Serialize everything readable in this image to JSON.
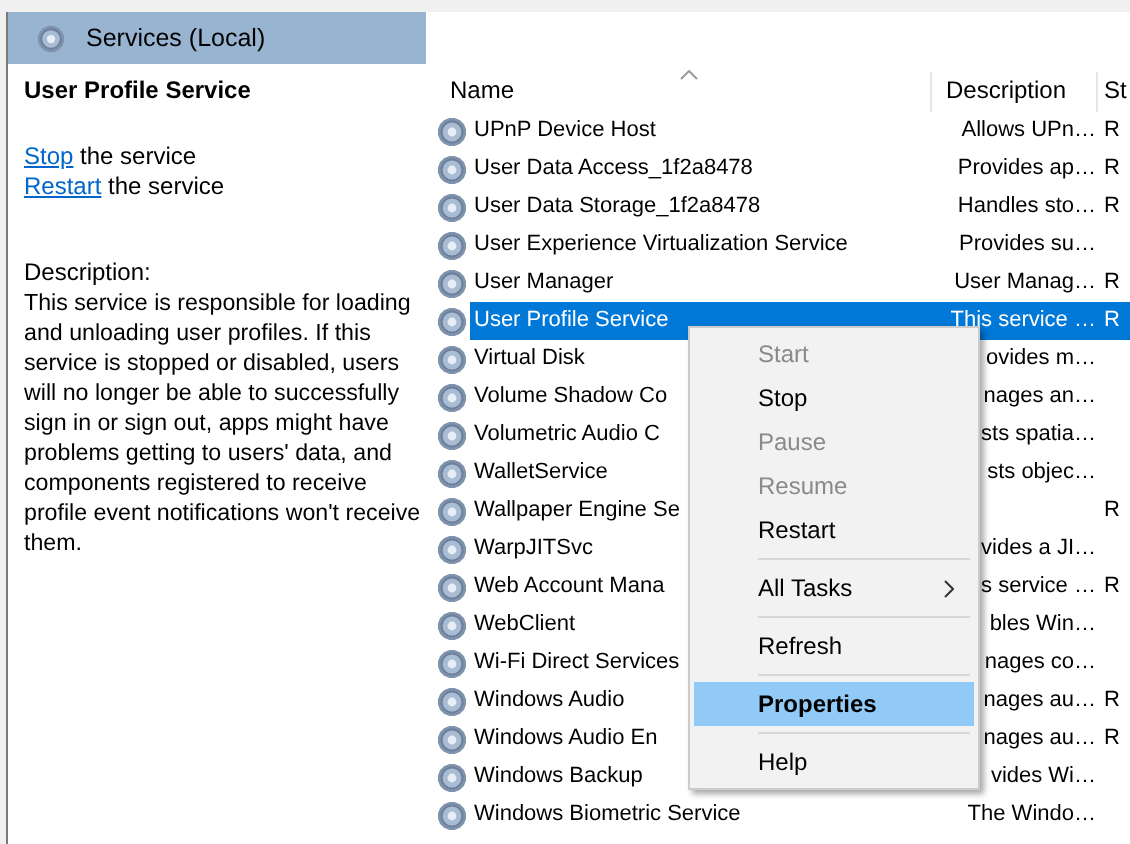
{
  "header": {
    "title": "Services (Local)"
  },
  "details": {
    "title": "User Profile Service",
    "actions": [
      {
        "link": "Stop",
        "text": " the service"
      },
      {
        "link": "Restart",
        "text": " the service"
      }
    ],
    "description_label": "Description:",
    "description": "This service is responsible for loading and unloading user profiles. If this service is stopped or disabled, users will no longer be able to successfully sign in or sign out, apps might have problems getting to users' data, and components registered to receive profile event notifications won't receive them."
  },
  "table": {
    "columns": [
      {
        "label": "Name",
        "sorted": true
      },
      {
        "label": "Description",
        "sorted": false
      },
      {
        "label": "St",
        "sorted": false
      }
    ],
    "rows": [
      {
        "name": "UPnP Device Host",
        "description": "Allows UPn…",
        "status": "R",
        "selected": false
      },
      {
        "name": "User Data Access_1f2a8478",
        "description": "Provides ap…",
        "status": "R",
        "selected": false
      },
      {
        "name": "User Data Storage_1f2a8478",
        "description": "Handles sto…",
        "status": "R",
        "selected": false
      },
      {
        "name": "User Experience Virtualization Service",
        "description": "Provides su…",
        "selected": false
      },
      {
        "name": "User Manager",
        "description": "User Manag…",
        "status": "R",
        "selected": false
      },
      {
        "name": "User Profile Service",
        "description": "This service …",
        "status": "R",
        "selected": true
      },
      {
        "name": "Virtual Disk",
        "description": "ovides m…",
        "selected": false
      },
      {
        "name": "Volume Shadow Co",
        "description": "nages an…",
        "selected": false
      },
      {
        "name": "Volumetric Audio C",
        "description": "sts spatia…",
        "selected": false
      },
      {
        "name": "WalletService",
        "description": "sts objec…",
        "selected": false
      },
      {
        "name": "Wallpaper Engine Se",
        "status": "R",
        "selected": false
      },
      {
        "name": "WarpJITSvc",
        "description": "vides a JI…",
        "selected": false
      },
      {
        "name": "Web Account Mana",
        "description": "s service …",
        "status": "R",
        "selected": false
      },
      {
        "name": "WebClient",
        "description": "bles Win…",
        "selected": false
      },
      {
        "name": "Wi-Fi Direct Services",
        "description": "nages co…",
        "selected": false
      },
      {
        "name": "Windows Audio",
        "description": "nages au…",
        "status": "R",
        "selected": false
      },
      {
        "name": "Windows Audio En",
        "description": "nages au…",
        "status": "R",
        "selected": false
      },
      {
        "name": "Windows Backup",
        "description": "vides Wi…",
        "selected": false
      },
      {
        "name": "Windows Biometric Service",
        "description": "The Windo…",
        "selected": false
      }
    ]
  },
  "context_menu": {
    "items": [
      {
        "kind": "item",
        "label": "Start",
        "disabled": true,
        "selected": false
      },
      {
        "kind": "item",
        "label": "Stop",
        "disabled": false,
        "selected": false
      },
      {
        "kind": "item",
        "label": "Pause",
        "disabled": true,
        "selected": false
      },
      {
        "kind": "item",
        "label": "Resume",
        "disabled": true,
        "selected": false
      },
      {
        "kind": "item",
        "label": "Restart",
        "disabled": false,
        "selected": false
      },
      {
        "kind": "separator"
      },
      {
        "kind": "submenu",
        "label": "All Tasks",
        "disabled": false,
        "selected": false
      },
      {
        "kind": "separator"
      },
      {
        "kind": "item",
        "label": "Refresh",
        "disabled": false,
        "selected": false
      },
      {
        "kind": "separator"
      },
      {
        "kind": "item",
        "label": "Properties",
        "disabled": false,
        "selected": true,
        "default": true
      },
      {
        "kind": "separator"
      },
      {
        "kind": "item",
        "label": "Help",
        "disabled": false,
        "selected": false
      }
    ]
  }
}
